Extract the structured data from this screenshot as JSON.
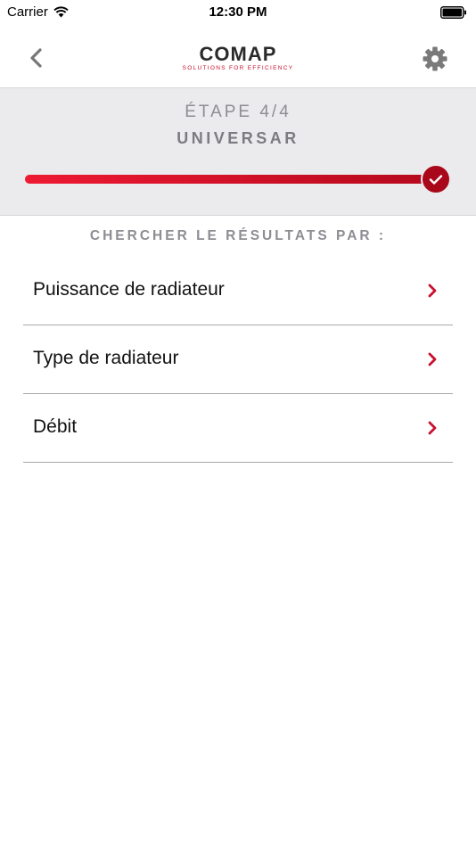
{
  "status_bar": {
    "carrier": "Carrier",
    "time": "12:30 PM",
    "icons": [
      "wifi-icon",
      "battery-icon"
    ]
  },
  "nav": {
    "logo_text": "COMAP",
    "logo_tagline": "SOLUTIONS FOR EFFICIENCY",
    "icons": [
      "chevron-left-icon",
      "gear-icon"
    ]
  },
  "step": {
    "label": "ÉTAPE 4/4",
    "name": "UNIVERSAR",
    "progress": 1.0,
    "completed_icon": "check-icon"
  },
  "section": {
    "title": "CHERCHER LE RÉSULTATS PAR :"
  },
  "options": [
    {
      "label": "Puissance de radiateur"
    },
    {
      "label": "Type de radiateur"
    },
    {
      "label": "Débit"
    }
  ],
  "colors": {
    "accent": "#c8102e",
    "header_bg": "#ebebed",
    "muted_text": "#8d8d93"
  }
}
